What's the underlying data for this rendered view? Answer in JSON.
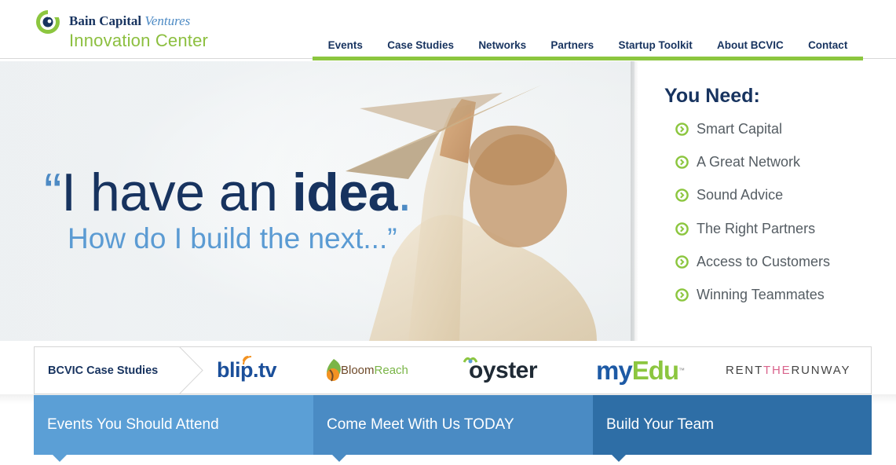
{
  "brand": {
    "line1": "Bain Capital",
    "line1_italic": "Ventures",
    "line2": "Innovation Center",
    "colors": {
      "navy": "#17335f",
      "green": "#8cc63f",
      "blue": "#5b9bd3"
    }
  },
  "nav": {
    "items": [
      {
        "label": "Events"
      },
      {
        "label": "Case Studies"
      },
      {
        "label": "Networks"
      },
      {
        "label": "Partners"
      },
      {
        "label": "Startup Toolkit"
      },
      {
        "label": "About BCVIC"
      },
      {
        "label": "Contact"
      }
    ]
  },
  "hero": {
    "quote_open": "“",
    "line1_regular": "I have an ",
    "line1_bold": "idea",
    "line1_end": ".",
    "line2": "How do I build the next...”"
  },
  "needs": {
    "title": "You Need:",
    "icon": "circle-arrow-right-icon",
    "items": [
      {
        "label": "Smart Capital"
      },
      {
        "label": "A Great Network"
      },
      {
        "label": "Sound Advice"
      },
      {
        "label": "The Right Partners"
      },
      {
        "label": "Access to Customers"
      },
      {
        "label": "Winning Teammates"
      }
    ]
  },
  "case_studies": {
    "label": "BCVIC Case Studies",
    "logos": {
      "blip": "blip.tv",
      "bloom_1": "Bloom",
      "bloom_2": "Reach",
      "oyster": "oyster",
      "myedu_1": "my",
      "myedu_2": "Edu",
      "myedu_tm": "™",
      "rtr_1": "RENT",
      "rtr_2": "THE",
      "rtr_3": "RUNWAY"
    }
  },
  "tabs": [
    {
      "label": "Events You Should Attend"
    },
    {
      "label": "Come Meet With Us TODAY"
    },
    {
      "label": "Build Your Team"
    }
  ]
}
